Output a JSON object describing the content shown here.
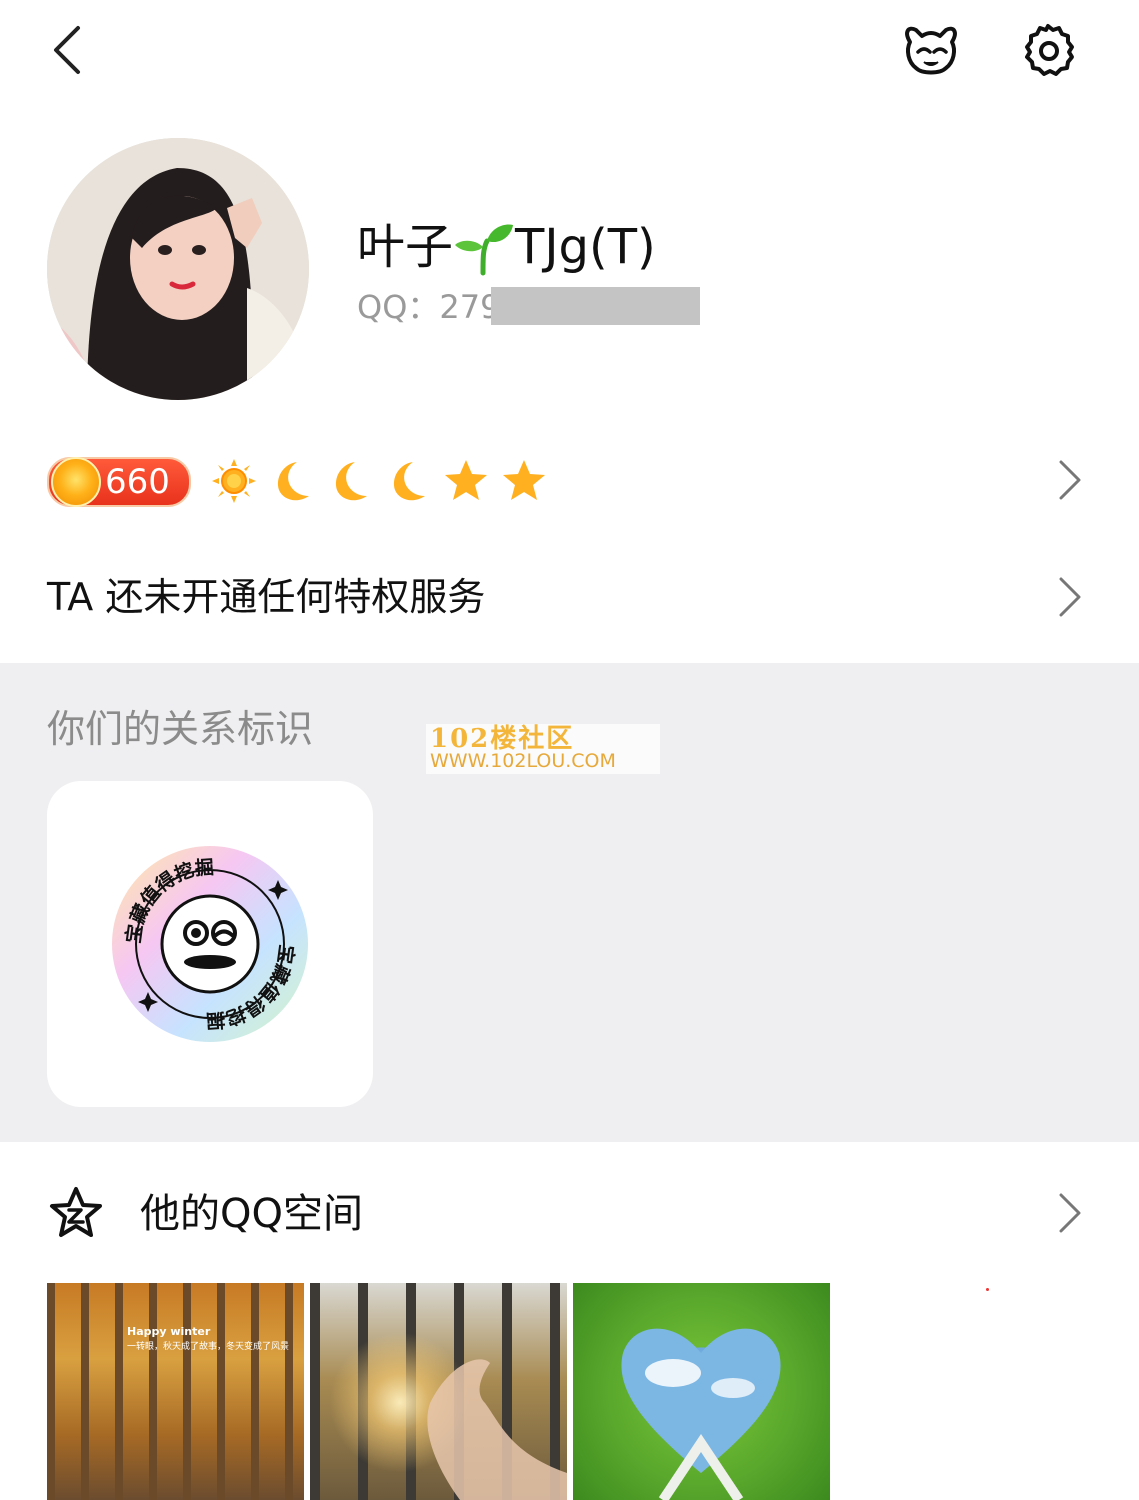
{
  "header": {
    "back_icon": "chevron-left-icon",
    "pet_icon": "qq-penguin-mascot-icon",
    "settings_icon": "gear-icon"
  },
  "profile": {
    "nickname_prefix": "叶子",
    "nickname_emoji": "seedling-icon",
    "nickname_suffix": "TJg(T)",
    "qq_label": "QQ：",
    "qq_visible_digits": "279"
  },
  "level": {
    "value": "660",
    "icons": [
      "sun-icon",
      "moon-icon",
      "moon-icon",
      "moon-icon",
      "star-icon",
      "star-icon"
    ],
    "coin_color": "#ffb21a",
    "badge_color": "#e8321c"
  },
  "privilege": {
    "text": "TA 还未开通任何特权服务"
  },
  "relation": {
    "title": "你们的关系标识",
    "badge_text_top": "宝藏值得挖掘",
    "badge_text_bottom": "宝藏值得挖掘"
  },
  "watermark": {
    "line1": "102楼社区",
    "line2": "WWW.102LOU.COM"
  },
  "qzone": {
    "title": "他的QQ空间",
    "photos": [
      {
        "caption": "Happy winter",
        "subcaption": "一转眼，秋天成了故事，冬天变成了风景"
      },
      {
        "caption": "",
        "subcaption": ""
      },
      {
        "caption": "",
        "subcaption": ""
      }
    ]
  },
  "colors": {
    "section_bg": "#efeff1",
    "muted_text": "#8b8b8b",
    "primary_text": "#111111"
  }
}
